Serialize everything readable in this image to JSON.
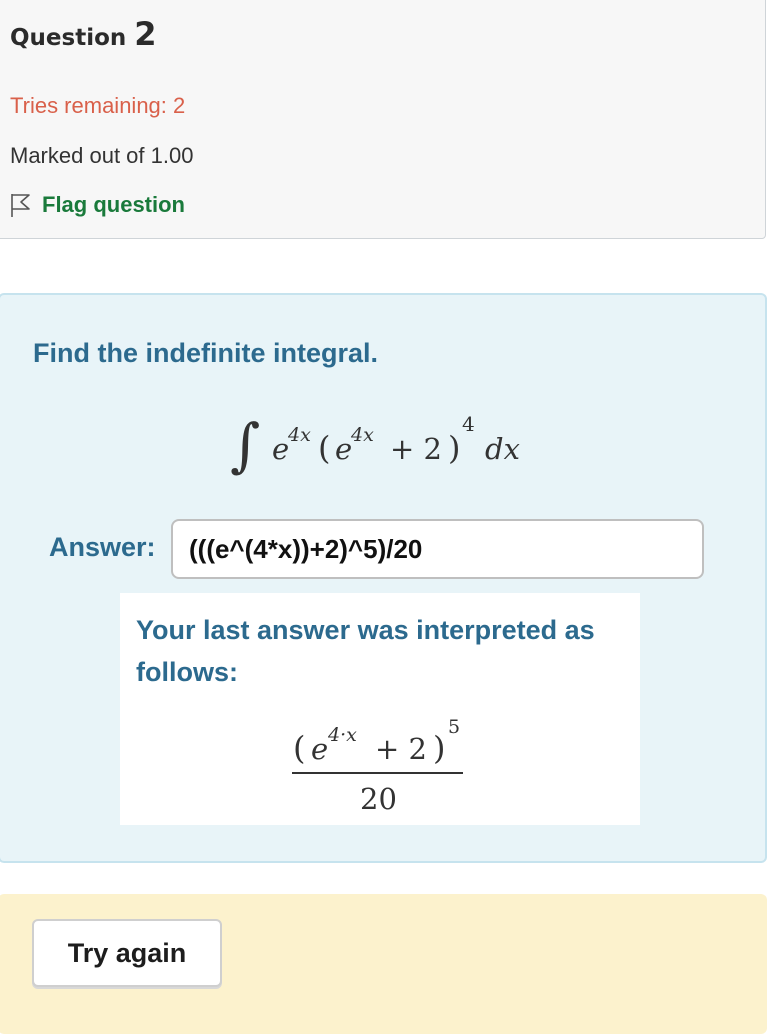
{
  "question": {
    "label": "Question",
    "number": "2",
    "tries_remaining": "Tries remaining: 2",
    "marked_out_of": "Marked out of 1.00",
    "flag_label": "Flag question",
    "flag_icon": "flag-outline-icon"
  },
  "problem": {
    "prompt": "Find the indefinite integral.",
    "integral_sign": "∫",
    "base": "e",
    "exponent": "4x",
    "inner_open": "(",
    "inner_base": "e",
    "inner_exponent": "4x",
    "plus_two": "+ 2",
    "inner_close": ")",
    "outer_power": "4",
    "differential": "dx"
  },
  "answer": {
    "label": "Answer:",
    "value": "(((e^(4*x))+2)^5)/20"
  },
  "interpretation": {
    "text": "Your last answer was interpreted as follows:",
    "open": "(",
    "base": "e",
    "exponent": "4·x",
    "plus_two": "+ 2",
    "close": ")",
    "power": "5",
    "denominator": "20"
  },
  "actions": {
    "try_again_label": "Try again"
  },
  "colors": {
    "tries": "#d9604a",
    "flag": "#1a7a3b",
    "prompt_blue": "#2c6a8e",
    "formula_bg": "#e8f4f8",
    "action_bg": "#fcf2cd"
  }
}
